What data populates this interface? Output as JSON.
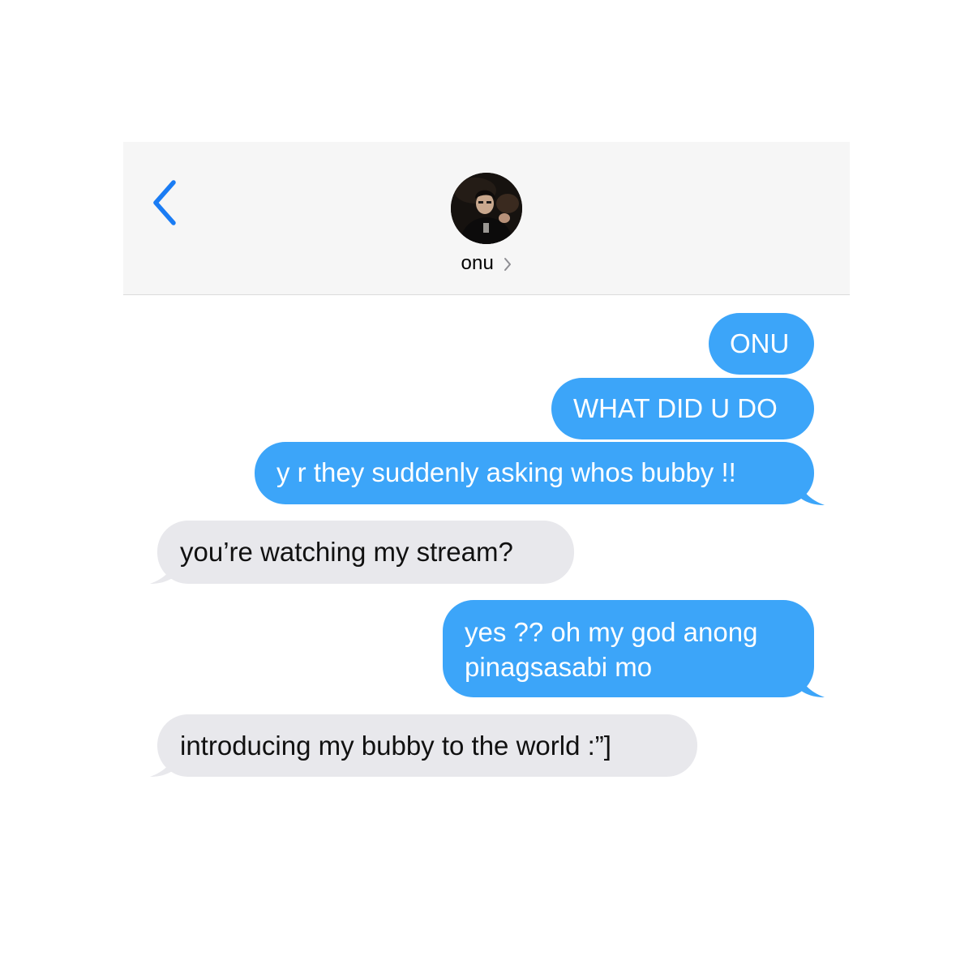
{
  "header": {
    "contact_name": "onu",
    "avatar_icon": "profile-photo",
    "back_icon": "chevron-left-icon",
    "chevron_icon": "chevron-right-icon"
  },
  "messages": [
    {
      "side": "sent",
      "text": "ONU"
    },
    {
      "side": "sent",
      "text": "WHAT DID U DO"
    },
    {
      "side": "sent",
      "text": "y r they suddenly asking whos bubby !!"
    },
    {
      "side": "received",
      "text": "you’re watching my stream?"
    },
    {
      "side": "sent",
      "text": "yes ?? oh my god anong pinagsasabi mo"
    },
    {
      "side": "received",
      "text": "introducing my bubby to the world :”]"
    }
  ],
  "colors": {
    "sent_bubble": "#3ca5f9",
    "received_bubble": "#e8e8ec",
    "accent_back": "#1a7cf4",
    "header_bg": "#f6f6f6"
  }
}
